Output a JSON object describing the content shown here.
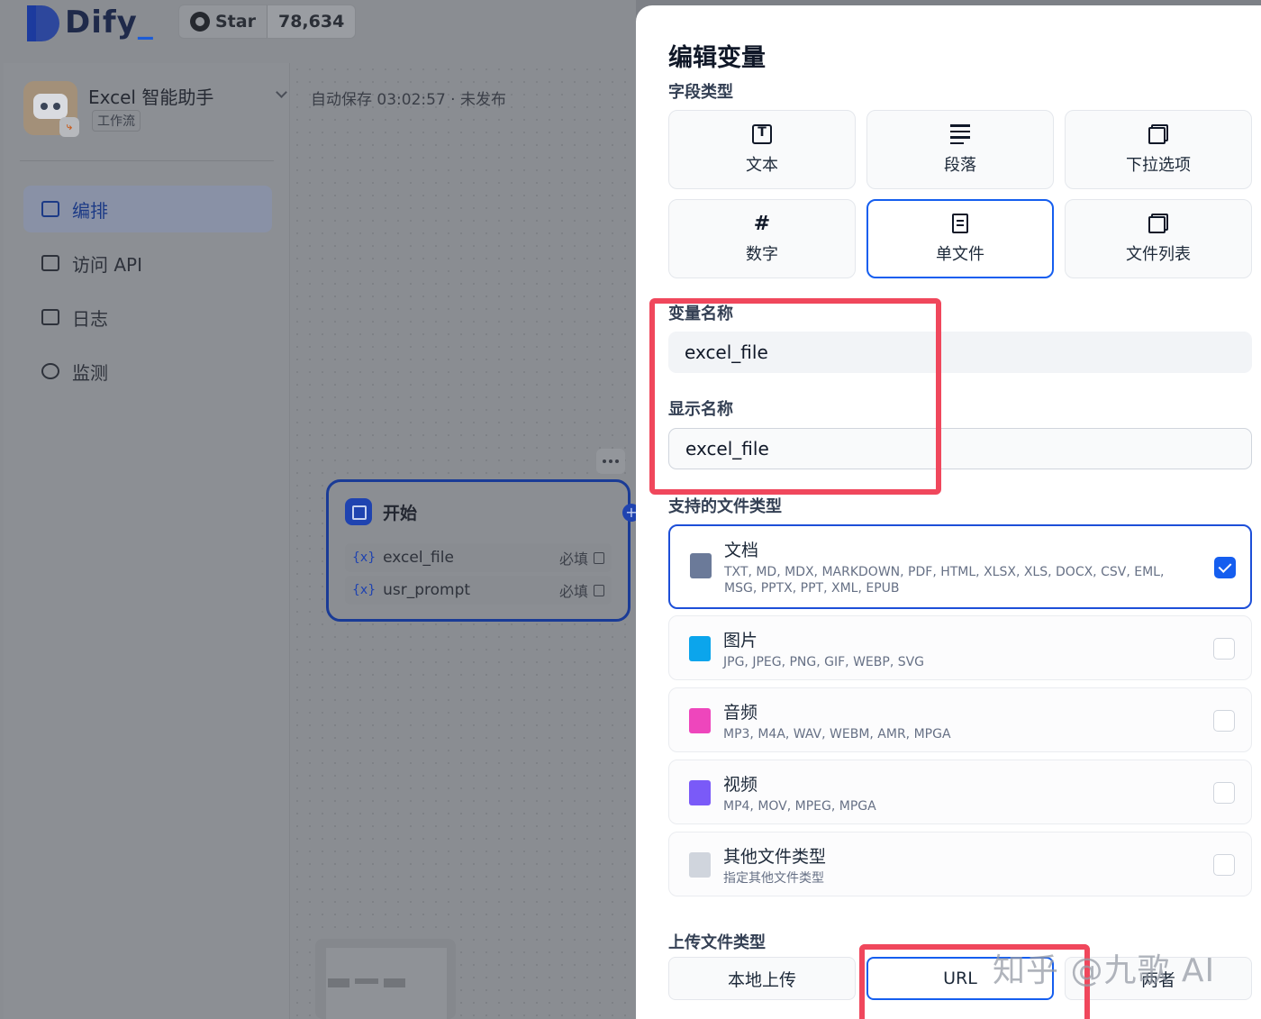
{
  "header": {
    "logo_text": "Dify",
    "github_star_label": "Star",
    "github_star_count": "78,634"
  },
  "app": {
    "name": "Excel 智能助手",
    "type": "工作流",
    "autosave_status": "自动保存 03:02:57 · 未发布"
  },
  "sidebar": {
    "items": [
      {
        "label": "编排",
        "active": true
      },
      {
        "label": "访问 API",
        "active": false
      },
      {
        "label": "日志",
        "active": false
      },
      {
        "label": "监测",
        "active": false
      }
    ]
  },
  "node": {
    "title": "开始",
    "variables": [
      {
        "icon_text": "{x}",
        "name": "excel_file",
        "required_label": "必填"
      },
      {
        "icon_text": "{x}",
        "name": "usr_prompt",
        "required_label": "必填"
      }
    ]
  },
  "panel": {
    "title": "编辑变量",
    "field_type_label": "字段类型",
    "field_types": [
      {
        "label": "文本",
        "icon": "text-box-icon",
        "selected": false
      },
      {
        "label": "段落",
        "icon": "paragraph-icon",
        "selected": false
      },
      {
        "label": "下拉选项",
        "icon": "select-icon",
        "selected": false
      },
      {
        "label": "数字",
        "icon": "hash-icon",
        "selected": false
      },
      {
        "label": "单文件",
        "icon": "file-icon",
        "selected": true
      },
      {
        "label": "文件列表",
        "icon": "file-list-icon",
        "selected": false
      }
    ],
    "variable_name_label": "变量名称",
    "variable_name_value": "excel_file",
    "display_name_label": "显示名称",
    "display_name_value": "excel_file",
    "supported_types_label": "支持的文件类型",
    "file_types": [
      {
        "title": "文档",
        "desc": "TXT, MD, MDX, MARKDOWN, PDF, HTML, XLSX, XLS, DOCX, CSV, EML, MSG, PPTX, PPT, XML, EPUB",
        "checked": true,
        "color": "#6b7a99"
      },
      {
        "title": "图片",
        "desc": "JPG, JPEG, PNG, GIF, WEBP, SVG",
        "checked": false,
        "color": "#0ba5ec"
      },
      {
        "title": "音频",
        "desc": "MP3, M4A, WAV, WEBM, AMR, MPGA",
        "checked": false,
        "color": "#ee46bc"
      },
      {
        "title": "视频",
        "desc": "MP4, MOV, MPEG, MPGA",
        "checked": false,
        "color": "#7a5af8"
      },
      {
        "title": "其他文件类型",
        "desc": "指定其他文件类型",
        "checked": false,
        "color": "#d0d5dd"
      }
    ],
    "upload_type_label": "上传文件类型",
    "upload_options": [
      {
        "label": "本地上传",
        "selected": false
      },
      {
        "label": "URL",
        "selected": true
      },
      {
        "label": "两者",
        "selected": false
      }
    ]
  },
  "watermark": "知乎 @九歌 AI",
  "colors": {
    "accent": "#155eef",
    "highlight_box": "#f0475c"
  }
}
